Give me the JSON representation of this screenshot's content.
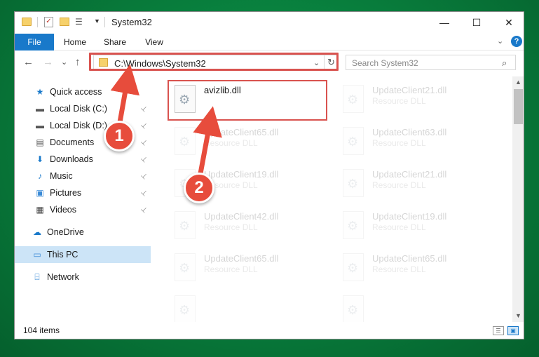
{
  "window": {
    "title": "System32",
    "minimize": "—",
    "maximize": "☐",
    "close": "✕"
  },
  "ribbon": {
    "tabs": [
      "File",
      "Home",
      "Share",
      "View"
    ],
    "expand": "⌄",
    "help": "?"
  },
  "nav": {
    "back": "←",
    "forward": "→",
    "recent": "⌄",
    "up": "↑",
    "address": "C:\\Windows\\System32",
    "address_dropdown": "⌄",
    "refresh": "↻",
    "search_placeholder": "Search System32",
    "search_icon": "⌕"
  },
  "sidebar": {
    "items": [
      {
        "label": "Quick access",
        "icon": "star-icon",
        "glyph": "★",
        "color": "#1979ca",
        "pinned": false
      },
      {
        "label": "Local Disk (C:)",
        "icon": "drive-icon",
        "glyph": "▬",
        "color": "#555555",
        "pinned": true
      },
      {
        "label": "Local Disk (D:)",
        "icon": "drive-icon",
        "glyph": "▬",
        "color": "#555555",
        "pinned": true
      },
      {
        "label": "Documents",
        "icon": "documents-icon",
        "glyph": "▤",
        "color": "#555555",
        "pinned": true
      },
      {
        "label": "Downloads",
        "icon": "download-icon",
        "glyph": "⬇",
        "color": "#1979ca",
        "pinned": true
      },
      {
        "label": "Music",
        "icon": "music-icon",
        "glyph": "♪",
        "color": "#1979ca",
        "pinned": true
      },
      {
        "label": "Pictures",
        "icon": "pictures-icon",
        "glyph": "▣",
        "color": "#3a8ad6",
        "pinned": true
      },
      {
        "label": "Videos",
        "icon": "film-icon",
        "glyph": "▦",
        "color": "#444444",
        "pinned": true
      },
      {
        "label": "OneDrive",
        "icon": "cloud-icon",
        "glyph": "☁",
        "color": "#1979ca",
        "pinned": false
      },
      {
        "label": "This PC",
        "icon": "computer-icon",
        "glyph": "▭",
        "color": "#3a8ad6",
        "pinned": false,
        "selected": true
      },
      {
        "label": "Network",
        "icon": "network-icon",
        "glyph": "⌸",
        "color": "#3a8ad6",
        "pinned": false
      }
    ],
    "pin_glyph": "📌"
  },
  "files": [
    {
      "name": "avizlib.dll",
      "type": "",
      "faded": false
    },
    {
      "name": "UpdateClient21.dll",
      "type": "Resource DLL",
      "faded": true
    },
    {
      "name": "UpdateClient65.dll",
      "type": "Resource DLL",
      "faded": true
    },
    {
      "name": "UpdateClient63.dll",
      "type": "Resource DLL",
      "faded": true
    },
    {
      "name": "UpdateClient19.dll",
      "type": "Resource DLL",
      "faded": true
    },
    {
      "name": "UpdateClient21.dll",
      "type": "Resource DLL",
      "faded": true
    },
    {
      "name": "UpdateClient42.dll",
      "type": "Resource DLL",
      "faded": true
    },
    {
      "name": "UpdateClient19.dll",
      "type": "Resource DLL",
      "faded": true
    },
    {
      "name": "UpdateClient65.dll",
      "type": "Resource DLL",
      "faded": true
    },
    {
      "name": "UpdateClient65.dll",
      "type": "Resource DLL",
      "faded": true
    },
    {
      "name": "",
      "type": "",
      "faded": true
    },
    {
      "name": "",
      "type": "",
      "faded": true
    }
  ],
  "status": {
    "item_count": "104 items"
  },
  "annotations": {
    "step1": "1",
    "step2": "2",
    "arrow_color": "#e74c3c"
  }
}
